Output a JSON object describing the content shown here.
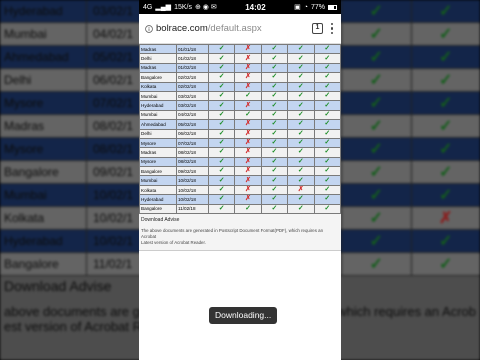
{
  "status": {
    "network": "4G",
    "speed": "15K/s",
    "time": "14:02",
    "battery": "77%"
  },
  "browser": {
    "url_host": "bolrace.com",
    "url_path": "/default.aspx",
    "tabs_count": "1"
  },
  "table": {
    "rows": [
      {
        "city": "Madras",
        "date": "01/01/18",
        "marks": [
          "tick",
          "cross",
          "tick",
          "tick",
          "tick"
        ]
      },
      {
        "city": "Delhi",
        "date": "01/02/18",
        "marks": [
          "tick",
          "cross",
          "tick",
          "tick",
          "tick"
        ]
      },
      {
        "city": "Madras",
        "date": "01/02/18",
        "marks": [
          "tick",
          "cross",
          "tick",
          "tick",
          "tick"
        ]
      },
      {
        "city": "Bangalore",
        "date": "02/02/18",
        "marks": [
          "tick",
          "cross",
          "tick",
          "tick",
          "tick"
        ]
      },
      {
        "city": "Kolkata",
        "date": "02/02/18",
        "marks": [
          "tick",
          "cross",
          "tick",
          "tick",
          "tick"
        ]
      },
      {
        "city": "Mumbai",
        "date": "03/02/18",
        "marks": [
          "tick",
          "tick",
          "tick",
          "tick",
          "tick"
        ]
      },
      {
        "city": "Hyderabad",
        "date": "03/02/18",
        "marks": [
          "tick",
          "cross",
          "tick",
          "tick",
          "tick"
        ]
      },
      {
        "city": "Mumbai",
        "date": "04/02/18",
        "marks": [
          "tick",
          "tick",
          "tick",
          "tick",
          "tick"
        ]
      },
      {
        "city": "Ahmedabad",
        "date": "05/02/18",
        "marks": [
          "tick",
          "cross",
          "tick",
          "tick",
          "tick"
        ]
      },
      {
        "city": "Delhi",
        "date": "06/02/18",
        "marks": [
          "tick",
          "cross",
          "tick",
          "tick",
          "tick"
        ]
      },
      {
        "city": "Mysore",
        "date": "07/02/18",
        "marks": [
          "tick",
          "cross",
          "tick",
          "tick",
          "tick"
        ]
      },
      {
        "city": "Madras",
        "date": "08/02/18",
        "marks": [
          "tick",
          "cross",
          "tick",
          "tick",
          "tick"
        ]
      },
      {
        "city": "Mysore",
        "date": "08/02/18",
        "marks": [
          "tick",
          "cross",
          "tick",
          "tick",
          "tick"
        ]
      },
      {
        "city": "Bangalore",
        "date": "09/02/18",
        "marks": [
          "tick",
          "cross",
          "tick",
          "tick",
          "tick"
        ]
      },
      {
        "city": "Mumbai",
        "date": "10/02/18",
        "marks": [
          "tick",
          "cross",
          "tick",
          "tick",
          "tick"
        ]
      },
      {
        "city": "Kolkata",
        "date": "10/02/18",
        "marks": [
          "tick",
          "cross",
          "tick",
          "cross",
          "tick"
        ]
      },
      {
        "city": "Hyderabad",
        "date": "10/02/18",
        "marks": [
          "tick",
          "cross",
          "tick",
          "tick",
          "tick"
        ]
      },
      {
        "city": "Bangalore",
        "date": "11/02/18",
        "marks": [
          "tick",
          "tick",
          "tick",
          "tick",
          "tick"
        ]
      }
    ]
  },
  "notes": {
    "heading": "Download Advise",
    "line1": "The above documents are generated in Postscript Document Format(PDF), which requires an Acrobat",
    "line2": "Latest version of Acrobat Reader."
  },
  "background": {
    "rows": [
      {
        "city": "Hyderabad",
        "date": "03/02/1",
        "marks": [
          "tick",
          "cross",
          "tick",
          "tick",
          "tick"
        ]
      },
      {
        "city": "Mumbai",
        "date": "04/02/1",
        "marks": [
          "tick",
          "tick",
          "tick",
          "tick",
          "tick"
        ]
      },
      {
        "city": "Ahmedabad",
        "date": "05/02/1",
        "marks": [
          "tick",
          "cross",
          "tick",
          "tick",
          "tick"
        ]
      },
      {
        "city": "Delhi",
        "date": "06/02/1",
        "marks": [
          "tick",
          "cross",
          "tick",
          "tick",
          "tick"
        ]
      },
      {
        "city": "Mysore",
        "date": "07/02/1",
        "marks": [
          "tick",
          "cross",
          "tick",
          "tick",
          "tick"
        ]
      },
      {
        "city": "Madras",
        "date": "08/02/1",
        "marks": [
          "tick",
          "cross",
          "tick",
          "tick",
          "tick"
        ]
      },
      {
        "city": "Mysore",
        "date": "08/02/1",
        "marks": [
          "tick",
          "cross",
          "tick",
          "tick",
          "tick"
        ]
      },
      {
        "city": "Bangalore",
        "date": "09/02/1",
        "marks": [
          "tick",
          "cross",
          "tick",
          "tick",
          "tick"
        ]
      },
      {
        "city": "Mumbai",
        "date": "10/02/1",
        "marks": [
          "tick",
          "cross",
          "tick",
          "tick",
          "tick"
        ]
      },
      {
        "city": "Kolkata",
        "date": "10/02/1",
        "marks": [
          "tick",
          "cross",
          "tick",
          "cross",
          "tick"
        ]
      },
      {
        "city": "Hyderabad",
        "date": "10/02/1",
        "marks": [
          "tick",
          "cross",
          "tick",
          "tick",
          "tick"
        ]
      },
      {
        "city": "Bangalore",
        "date": "11/02/1",
        "marks": [
          "tick",
          "tick",
          "tick",
          "tick",
          "tick"
        ]
      }
    ],
    "heading": "Download Advise",
    "line1": "above documents are gene",
    "line1_end": "DF), which requires an Acrob",
    "line2": "est version of Acrobat Reader"
  },
  "toast": {
    "message": "Downloading..."
  },
  "colors": {
    "tick": "#1f8f2a",
    "cross": "#d23030",
    "row_blue": "#c3d5f0",
    "row_grey": "#f1f1f1"
  }
}
